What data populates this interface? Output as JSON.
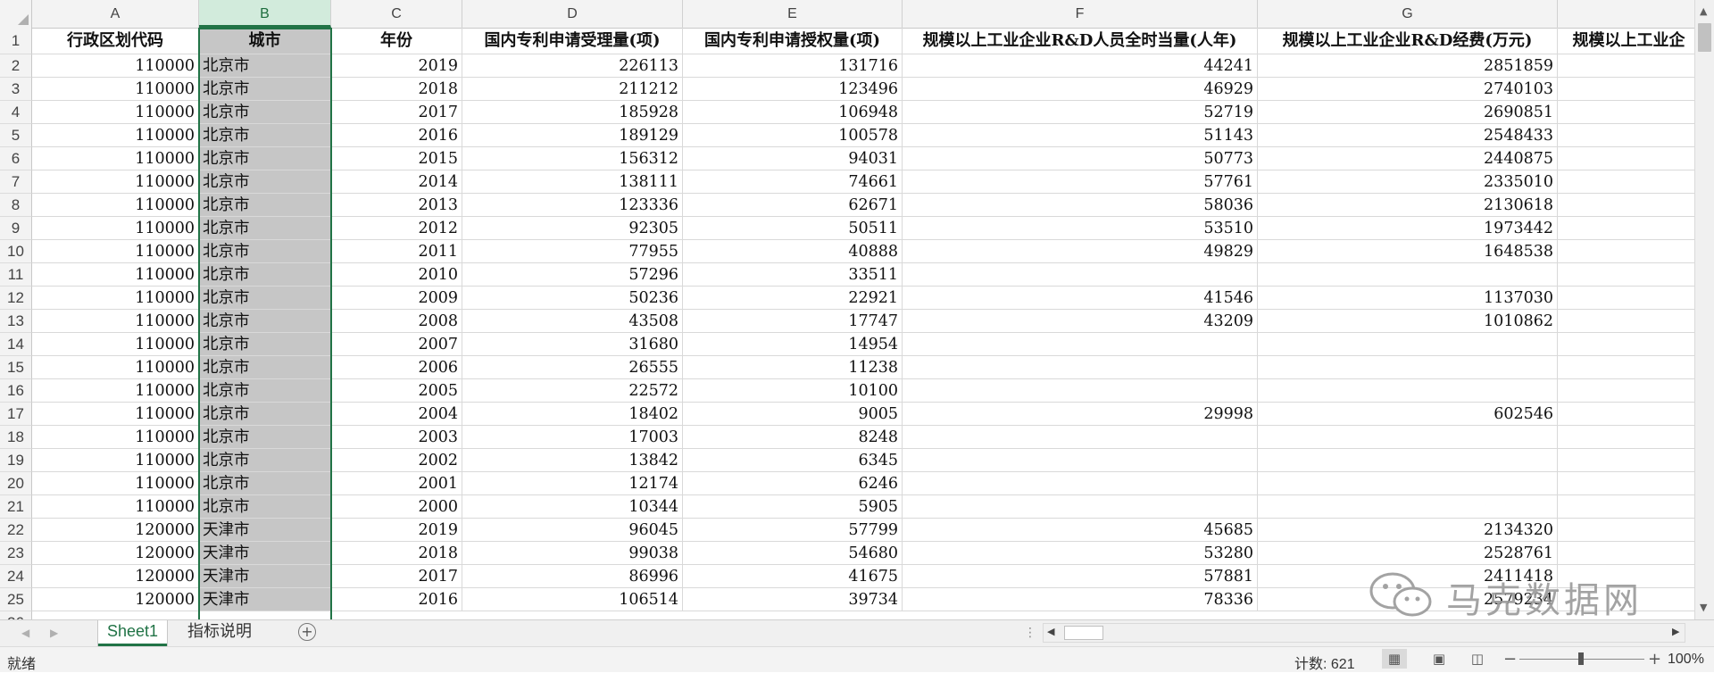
{
  "sheet": {
    "columns": [
      "A",
      "B",
      "C",
      "D",
      "E",
      "F",
      "G",
      ""
    ],
    "headers": [
      "行政区划代码",
      "城市",
      "年份",
      "国内专利申请受理量(项)",
      "国内专利申请授权量(项)",
      "规模以上工业企业R&D人员全时当量(人年)",
      "规模以上工业企业R&D经费(万元)",
      "规模以上工业企"
    ],
    "rows": [
      [
        "110000",
        "北京市",
        "2019",
        "226113",
        "131716",
        "44241",
        "2851859"
      ],
      [
        "110000",
        "北京市",
        "2018",
        "211212",
        "123496",
        "46929",
        "2740103"
      ],
      [
        "110000",
        "北京市",
        "2017",
        "185928",
        "106948",
        "52719",
        "2690851"
      ],
      [
        "110000",
        "北京市",
        "2016",
        "189129",
        "100578",
        "51143",
        "2548433"
      ],
      [
        "110000",
        "北京市",
        "2015",
        "156312",
        "94031",
        "50773",
        "2440875"
      ],
      [
        "110000",
        "北京市",
        "2014",
        "138111",
        "74661",
        "57761",
        "2335010"
      ],
      [
        "110000",
        "北京市",
        "2013",
        "123336",
        "62671",
        "58036",
        "2130618"
      ],
      [
        "110000",
        "北京市",
        "2012",
        "92305",
        "50511",
        "53510",
        "1973442"
      ],
      [
        "110000",
        "北京市",
        "2011",
        "77955",
        "40888",
        "49829",
        "1648538"
      ],
      [
        "110000",
        "北京市",
        "2010",
        "57296",
        "33511",
        "",
        ""
      ],
      [
        "110000",
        "北京市",
        "2009",
        "50236",
        "22921",
        "41546",
        "1137030"
      ],
      [
        "110000",
        "北京市",
        "2008",
        "43508",
        "17747",
        "43209",
        "1010862"
      ],
      [
        "110000",
        "北京市",
        "2007",
        "31680",
        "14954",
        "",
        ""
      ],
      [
        "110000",
        "北京市",
        "2006",
        "26555",
        "11238",
        "",
        ""
      ],
      [
        "110000",
        "北京市",
        "2005",
        "22572",
        "10100",
        "",
        ""
      ],
      [
        "110000",
        "北京市",
        "2004",
        "18402",
        "9005",
        "29998",
        "602546"
      ],
      [
        "110000",
        "北京市",
        "2003",
        "17003",
        "8248",
        "",
        ""
      ],
      [
        "110000",
        "北京市",
        "2002",
        "13842",
        "6345",
        "",
        ""
      ],
      [
        "110000",
        "北京市",
        "2001",
        "12174",
        "6246",
        "",
        ""
      ],
      [
        "110000",
        "北京市",
        "2000",
        "10344",
        "5905",
        "",
        ""
      ],
      [
        "120000",
        "天津市",
        "2019",
        "96045",
        "57799",
        "45685",
        "2134320"
      ],
      [
        "120000",
        "天津市",
        "2018",
        "99038",
        "54680",
        "53280",
        "2528761"
      ],
      [
        "120000",
        "天津市",
        "2017",
        "86996",
        "41675",
        "57881",
        "2411418"
      ],
      [
        "120000",
        "天津市",
        "2016",
        "106514",
        "39734",
        "78336",
        "2579234"
      ]
    ]
  },
  "tabs": {
    "sheet1": "Sheet1",
    "sheet2": "指标说明",
    "add": "+"
  },
  "status": {
    "ready": "就绪",
    "count": "计数: 621",
    "zoom": "100%"
  },
  "watermark": {
    "text": "马克数据网"
  },
  "icons": {
    "scroll_up": "▲",
    "scroll_down": "▼",
    "scroll_left": "◀",
    "scroll_right": "▶",
    "nav_prev": "◀",
    "nav_next": "▶",
    "view_normal": "▦",
    "view_layout": "▣",
    "view_pagebreak": "◫",
    "zoom_minus": "−",
    "zoom_plus": "+"
  },
  "colors": {
    "accent": "#217346",
    "selected_column": "#c6c6c6"
  }
}
